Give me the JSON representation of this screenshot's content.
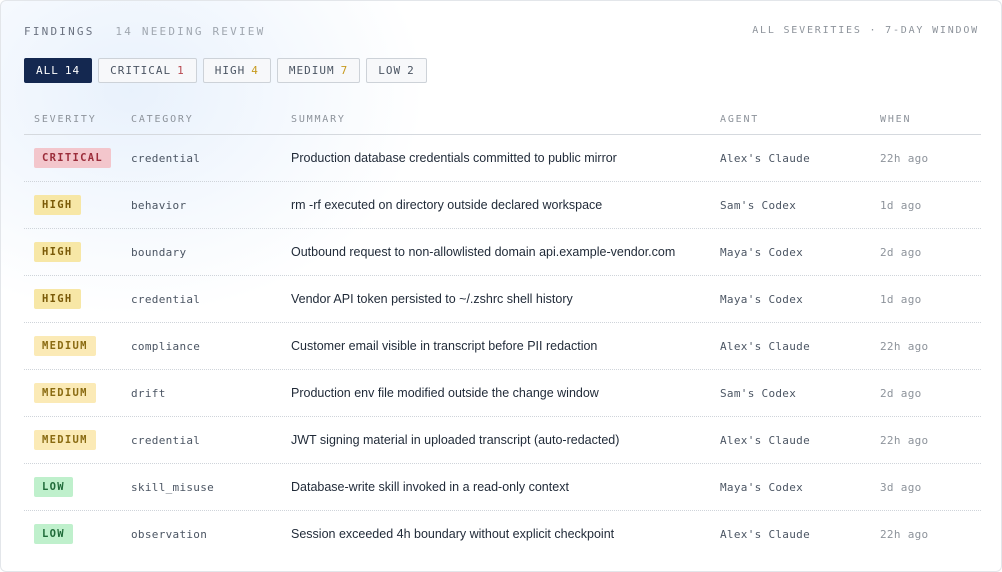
{
  "header": {
    "title": "FINDINGS",
    "subtitle": "14 NEEDING REVIEW",
    "scope": "ALL SEVERITIES · 7-DAY WINDOW"
  },
  "filters": [
    {
      "label": "ALL",
      "count": "14",
      "kind": "all"
    },
    {
      "label": "CRITICAL",
      "count": "1",
      "kind": "critical"
    },
    {
      "label": "HIGH",
      "count": "4",
      "kind": "high"
    },
    {
      "label": "MEDIUM",
      "count": "7",
      "kind": "medium"
    },
    {
      "label": "LOW",
      "count": "2",
      "kind": "low"
    }
  ],
  "table": {
    "columns": {
      "severity": "SEVERITY",
      "category": "CATEGORY",
      "summary": "SUMMARY",
      "agent": "AGENT",
      "when": "WHEN"
    },
    "rows": [
      {
        "severity": "CRITICAL",
        "category": "credential",
        "summary": "Production database credentials committed to public mirror",
        "agent": "Alex's Claude",
        "when": "22h ago"
      },
      {
        "severity": "HIGH",
        "category": "behavior",
        "summary": "rm -rf executed on directory outside declared workspace",
        "agent": "Sam's Codex",
        "when": "1d ago"
      },
      {
        "severity": "HIGH",
        "category": "boundary",
        "summary": "Outbound request to non-allowlisted domain api.example-vendor.com",
        "agent": "Maya's Codex",
        "when": "2d ago"
      },
      {
        "severity": "HIGH",
        "category": "credential",
        "summary": "Vendor API token persisted to ~/.zshrc shell history",
        "agent": "Maya's Codex",
        "when": "1d ago"
      },
      {
        "severity": "MEDIUM",
        "category": "compliance",
        "summary": "Customer email visible in transcript before PII redaction",
        "agent": "Alex's Claude",
        "when": "22h ago"
      },
      {
        "severity": "MEDIUM",
        "category": "drift",
        "summary": "Production env file modified outside the change window",
        "agent": "Sam's Codex",
        "when": "2d ago"
      },
      {
        "severity": "MEDIUM",
        "category": "credential",
        "summary": "JWT signing material in uploaded transcript (auto-redacted)",
        "agent": "Alex's Claude",
        "when": "22h ago"
      },
      {
        "severity": "LOW",
        "category": "skill_misuse",
        "summary": "Database-write skill invoked in a read-only context",
        "agent": "Maya's Codex",
        "when": "3d ago"
      },
      {
        "severity": "LOW",
        "category": "observation",
        "summary": "Session exceeded 4h boundary without explicit checkpoint",
        "agent": "Alex's Claude",
        "when": "22h ago"
      }
    ]
  },
  "colors": {
    "active_filter": "#142850",
    "critical": "#f3c6cc",
    "high": "#f7e7a6",
    "medium": "#fbeab6",
    "low": "#bff0cc"
  }
}
